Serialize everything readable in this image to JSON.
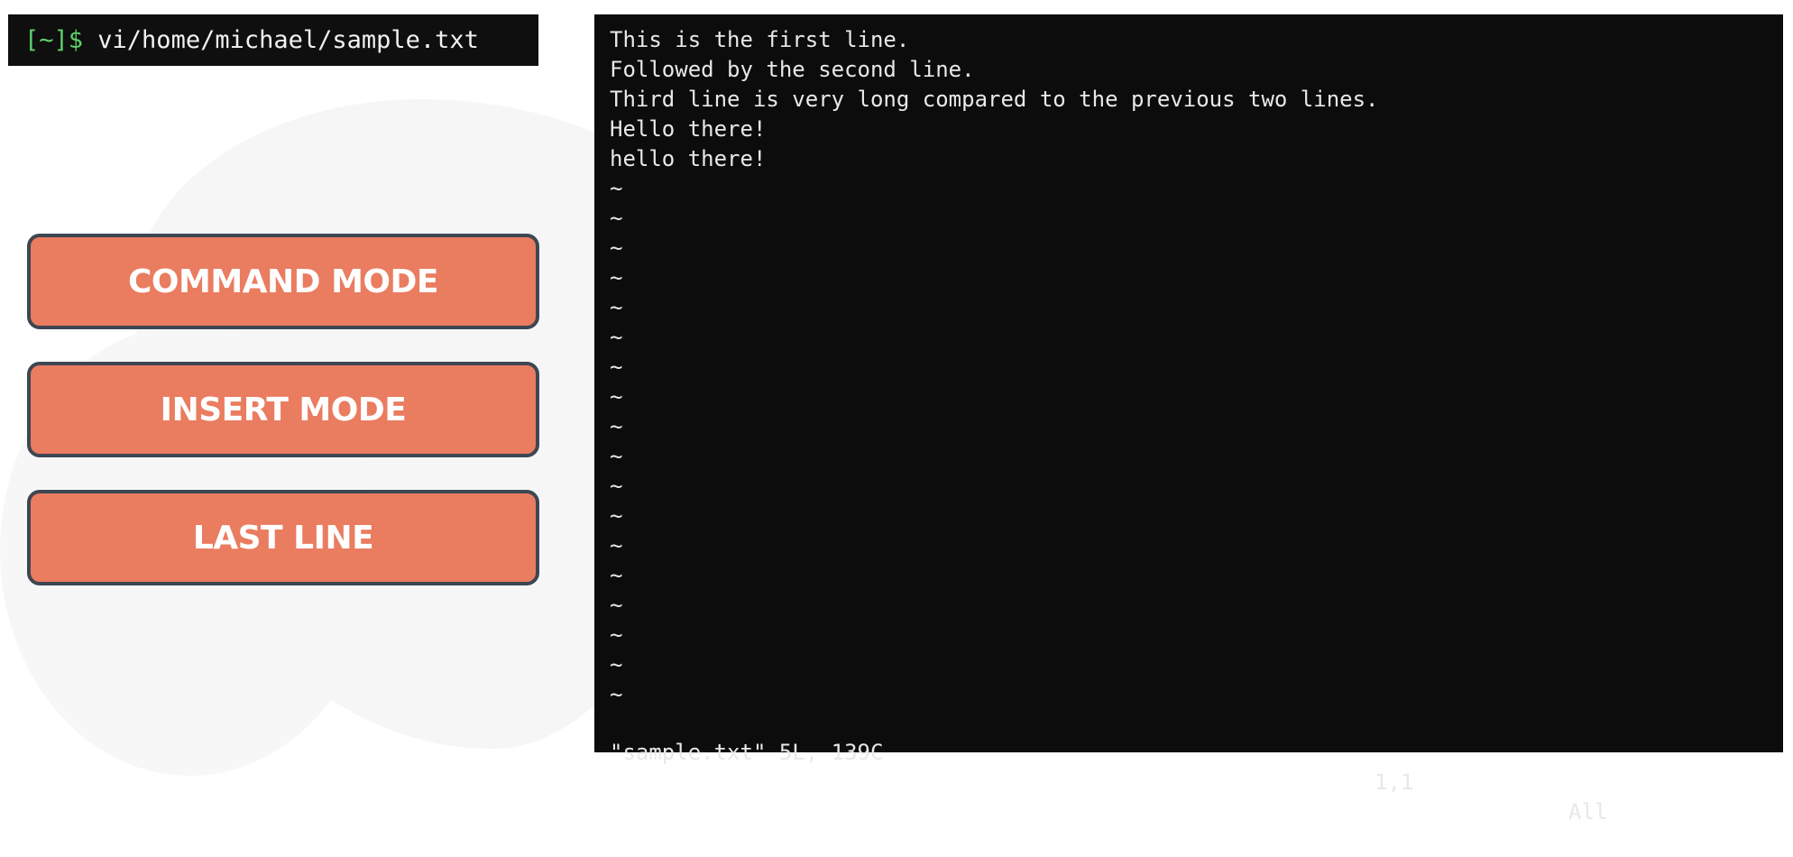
{
  "prompt": {
    "symbol": "[~]$",
    "command": " vi/home/michael/sample.txt"
  },
  "modes": [
    {
      "label": "COMMAND MODE"
    },
    {
      "label": "INSERT MODE"
    },
    {
      "label": "LAST LINE"
    }
  ],
  "colors": {
    "button_fill": "#ea7c60",
    "button_border": "#3d4652",
    "terminal_bg": "#0c0c0c",
    "prompt_green": "#5fd16a"
  },
  "editor": {
    "lines": [
      "This is the first line.",
      "Followed by the second line.",
      "Third line is very long compared to the previous two lines.",
      "Hello there!",
      "hello there!"
    ],
    "empty_marker": "~",
    "status": {
      "file_info": "\"sample.txt\" 5L, 139C",
      "cursor": "1,1",
      "view": "All"
    }
  }
}
